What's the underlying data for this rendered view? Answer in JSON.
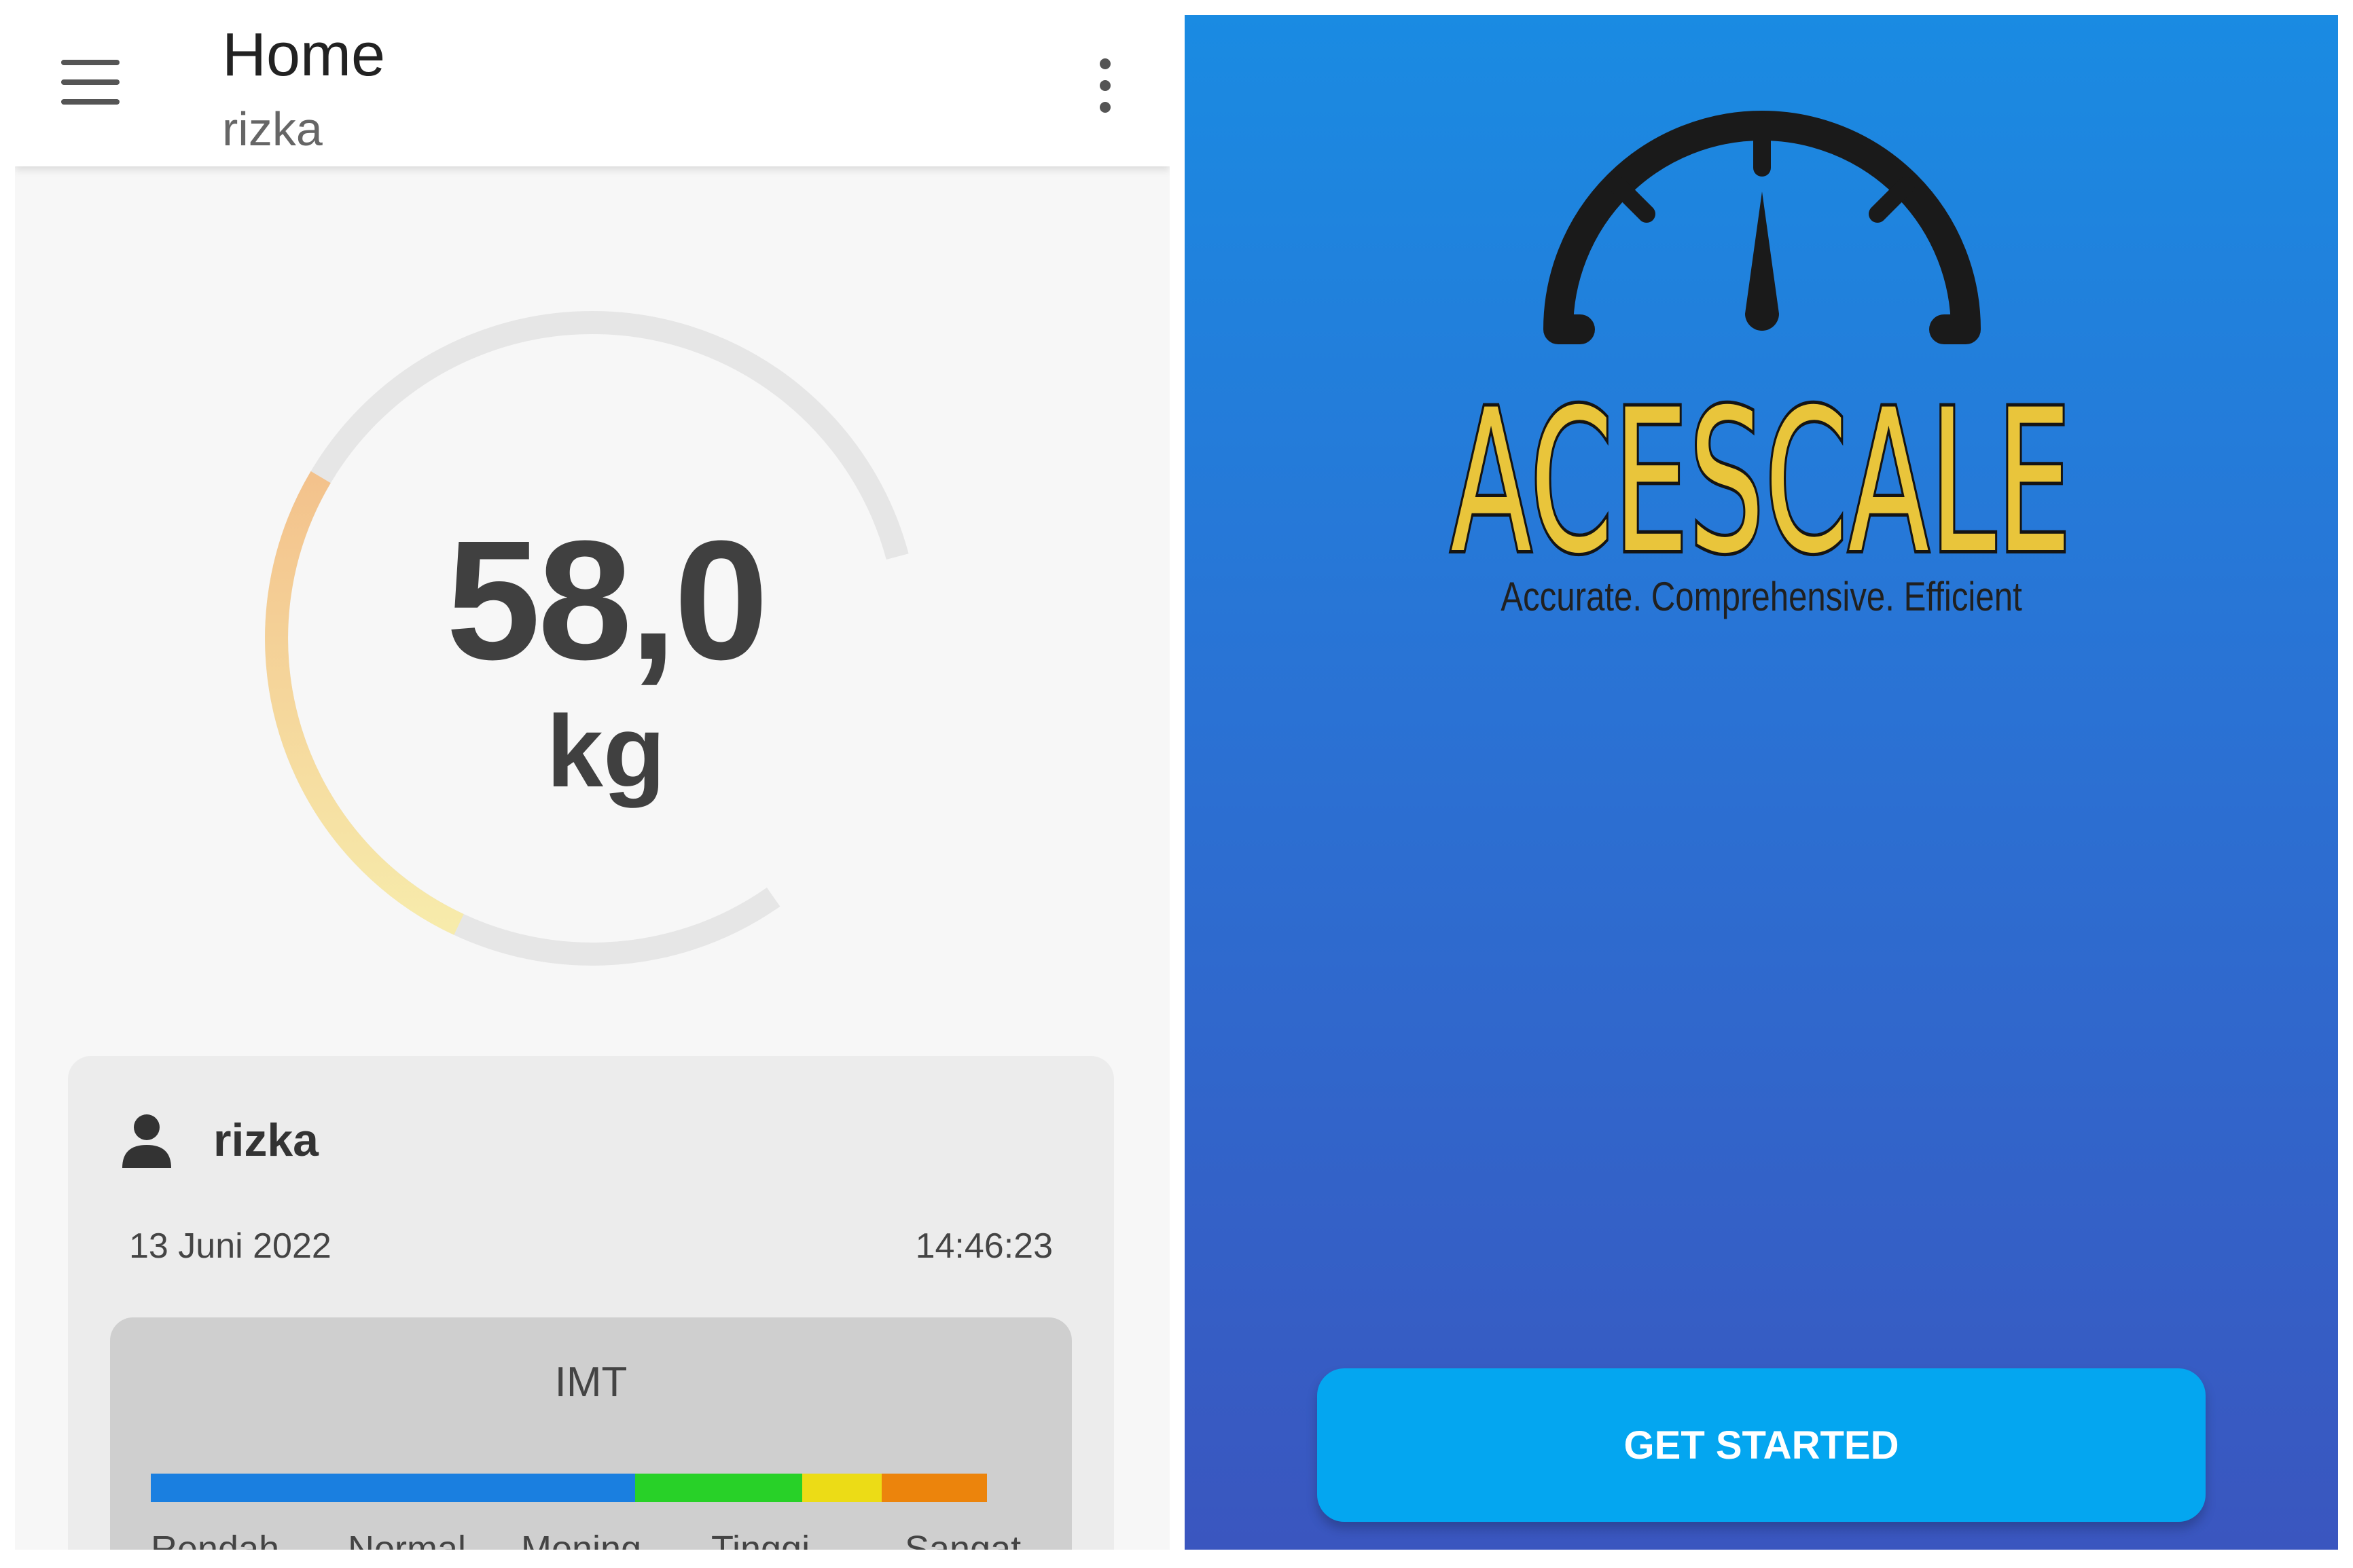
{
  "home": {
    "appbar": {
      "title": "Home",
      "subtitle": "rizka",
      "menu_icon": "menu-icon",
      "more_icon": "more-vert-icon"
    },
    "gauge": {
      "value": "58,0",
      "unit": "kg",
      "fill_fraction": 0.33,
      "track_color": "#e6e6e6",
      "fill_colors": [
        "#f3c28c",
        "#f7ebab"
      ]
    },
    "card": {
      "user_icon": "person-icon",
      "user_name": "rizka",
      "date": "13 Juni 2022",
      "time": "14:46:23",
      "imt": {
        "label": "IMT",
        "segments": [
          {
            "color": "#1a7fe0",
            "share": 0.55
          },
          {
            "color": "#28d128",
            "share": 0.19
          },
          {
            "color": "#ecdc16",
            "share": 0.09
          },
          {
            "color": "#ec840c",
            "share": 0.12
          }
        ],
        "categories": [
          "Rendah",
          "Normal",
          "Moning",
          "Tinggi",
          "Sangat"
        ]
      }
    }
  },
  "splash": {
    "logo_icon": "speedometer-icon",
    "brand_name": "ACESCALE",
    "tagline": "Accurate. Comprehensive. Efficient",
    "get_started_label": "GET STARTED",
    "colors": {
      "gradient_top": "#1a8be2",
      "gradient_bottom": "#3a56bf",
      "brand_fill": "#e9c53b",
      "button": "#04a6f0"
    }
  }
}
